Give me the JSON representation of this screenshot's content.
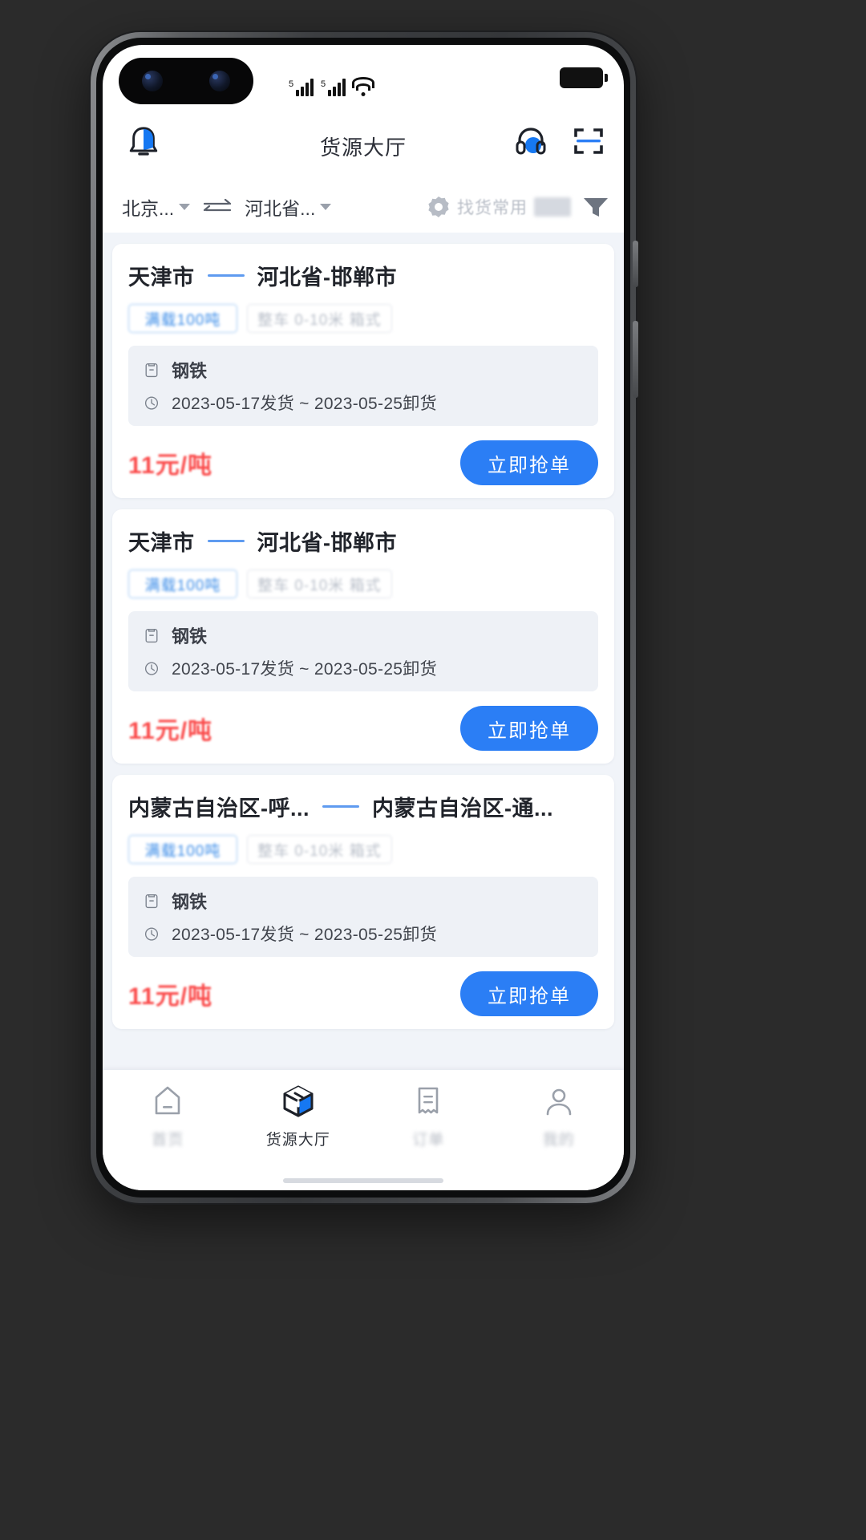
{
  "status_bar": {
    "signal_icon": "cellular-signal-icon",
    "signal_sup": "5",
    "wifi_icon": "wifi-icon",
    "battery_icon": "battery-icon"
  },
  "header": {
    "title": "货源大厅",
    "bell_icon": "bell-icon",
    "service_icon": "headset-icon",
    "scan_icon": "scan-qr-icon"
  },
  "filter_bar": {
    "origin": "北京...",
    "destination": "河北省...",
    "swap_icon": "swap-arrows-icon",
    "gear_icon": "gear-icon",
    "common_search_label": "找货常用",
    "funnel_icon": "filter-funnel-icon"
  },
  "cards": [
    {
      "origin": "天津市",
      "destination": "河北省-邯郸市",
      "tags": [
        "满载100吨",
        "整车 0-10米 箱式"
      ],
      "cargo_icon": "package-icon",
      "cargo_name": "钢铁",
      "clock_icon": "clock-icon",
      "schedule": "2023-05-17发货 ~ 2023-05-25卸货",
      "price": "11元/吨",
      "action_label": "立即抢单"
    },
    {
      "origin": "天津市",
      "destination": "河北省-邯郸市",
      "tags": [
        "满载100吨",
        "整车 0-10米 箱式"
      ],
      "cargo_icon": "package-icon",
      "cargo_name": "钢铁",
      "clock_icon": "clock-icon",
      "schedule": "2023-05-17发货 ~ 2023-05-25卸货",
      "price": "11元/吨",
      "action_label": "立即抢单"
    },
    {
      "origin": "内蒙古自治区-呼...",
      "destination": "内蒙古自治区-通...",
      "tags": [
        "满载100吨",
        "整车 0-10米 箱式"
      ],
      "cargo_icon": "package-icon",
      "cargo_name": "钢铁",
      "clock_icon": "clock-icon",
      "schedule": "2023-05-17发货 ~ 2023-05-25卸货",
      "price": "11元/吨",
      "action_label": "立即抢单"
    }
  ],
  "tab_bar": {
    "items": [
      {
        "label": "首页",
        "icon": "home-icon",
        "active": false,
        "blurred": true
      },
      {
        "label": "货源大厅",
        "icon": "cube-box-icon",
        "active": true,
        "blurred": false
      },
      {
        "label": "订单",
        "icon": "receipt-icon",
        "active": false,
        "blurred": true
      },
      {
        "label": "我的",
        "icon": "person-icon",
        "active": false,
        "blurred": true
      }
    ]
  },
  "colors": {
    "accent_blue": "#2b7ef5",
    "price_red": "#fa4b4b",
    "tag_border": "#9cc6f5",
    "bg_grey": "#f1f4f9"
  }
}
